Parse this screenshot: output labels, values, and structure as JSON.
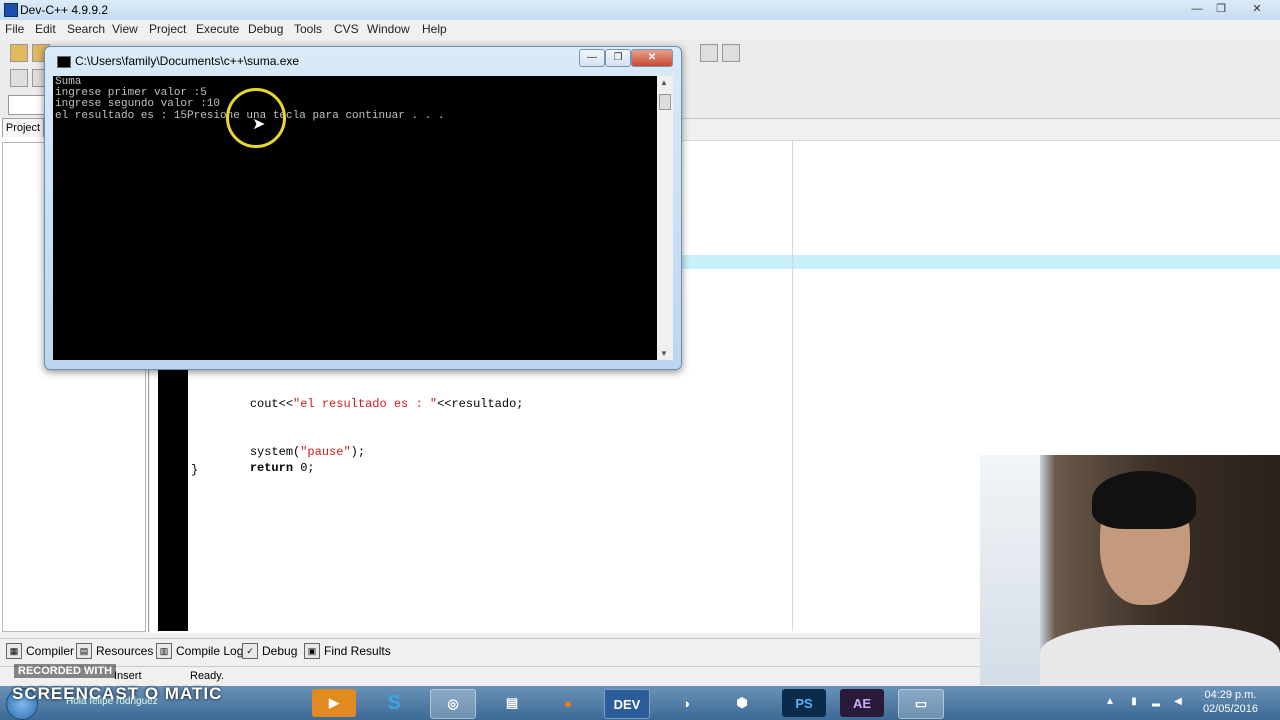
{
  "ide": {
    "title": "Dev-C++ 4.9.9.2",
    "window_controls": [
      "—",
      "❐",
      "✕"
    ],
    "menu": [
      "File",
      "Edit",
      "Search",
      "View",
      "Project",
      "Execute",
      "Debug",
      "Tools",
      "CVS",
      "Window",
      "Help"
    ],
    "left_tab": "Project",
    "code": {
      "line1_pre": "cout<<",
      "line1_str": "\"el resultado es : \"",
      "line1_post": "<<resultado;",
      "line2_pre": "system(",
      "line2_str": "\"pause\"",
      "line2_post": ");",
      "line3_kw": "return",
      "line3_post": " 0;",
      "line4": "}"
    },
    "bottom_tabs": [
      "Compiler",
      "Resources",
      "Compile Log",
      "Debug",
      "Find Results"
    ],
    "status": {
      "mode": "Insert",
      "state": "Ready."
    }
  },
  "console": {
    "title": "C:\\Users\\family\\Documents\\c++\\suma.exe",
    "lines": [
      "Suma",
      "ingrese primer valor :5",
      "ingrese segundo valor :10",
      "el resultado es : 15Presione una tecla para continuar . . ."
    ]
  },
  "overlay": {
    "recorded_with": "RECORDED WITH",
    "brand": "SCREENCAST O MATIC",
    "taskbar_hint": "Hola felipe rodriguez"
  },
  "taskbar": {
    "apps": [
      "PS",
      "AE"
    ],
    "time": "04:29 p.m.",
    "date": "02/05/2016"
  }
}
